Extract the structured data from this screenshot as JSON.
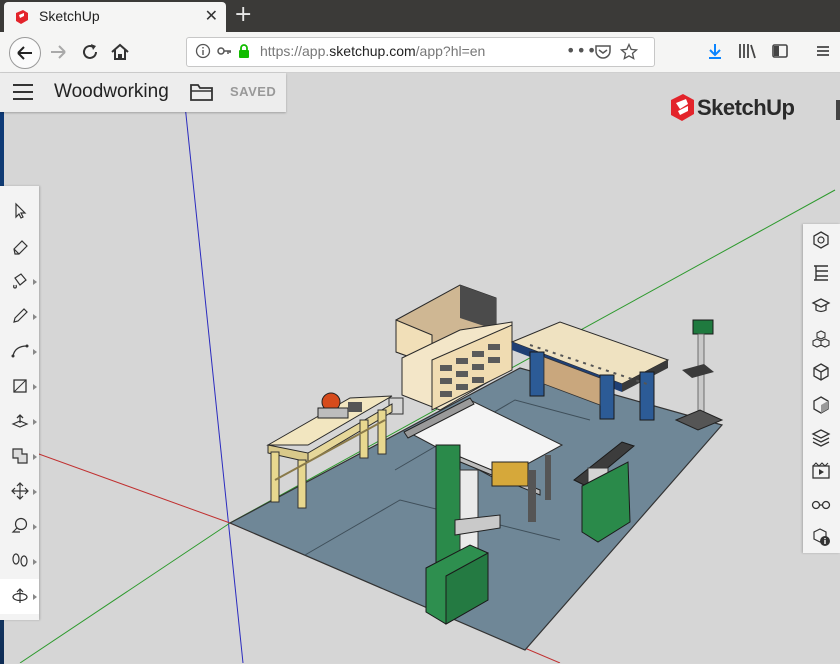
{
  "browser": {
    "tab_title": "SketchUp",
    "url_prefix": "https://app.",
    "url_domain": "sketchup.com",
    "url_path": "/app?hl=en"
  },
  "app": {
    "document_title": "Woodworking",
    "save_status": "SAVED",
    "logo_text": "SketchUp",
    "brand_color": "#e3242b"
  },
  "left_toolbar": [
    {
      "name": "select-icon",
      "has_menu": false
    },
    {
      "name": "eraser-icon",
      "has_menu": false
    },
    {
      "name": "paint-bucket-icon",
      "has_menu": true
    },
    {
      "name": "pencil-icon",
      "has_menu": true
    },
    {
      "name": "arc-icon",
      "has_menu": true
    },
    {
      "name": "rectangle-icon",
      "has_menu": true
    },
    {
      "name": "push-pull-icon",
      "has_menu": true
    },
    {
      "name": "offset-icon",
      "has_menu": true
    },
    {
      "name": "move-icon",
      "has_menu": true
    },
    {
      "name": "tape-measure-icon",
      "has_menu": true
    },
    {
      "name": "walk-icon",
      "has_menu": true
    },
    {
      "name": "orbit-icon",
      "has_menu": true,
      "active": true
    }
  ],
  "right_toolbar": [
    {
      "name": "entity-info-icon"
    },
    {
      "name": "outliner-icon"
    },
    {
      "name": "instructor-icon"
    },
    {
      "name": "components-icon"
    },
    {
      "name": "materials-icon"
    },
    {
      "name": "styles-icon"
    },
    {
      "name": "layers-icon"
    },
    {
      "name": "scenes-icon"
    },
    {
      "name": "display-icon"
    },
    {
      "name": "model-info-icon"
    }
  ]
}
